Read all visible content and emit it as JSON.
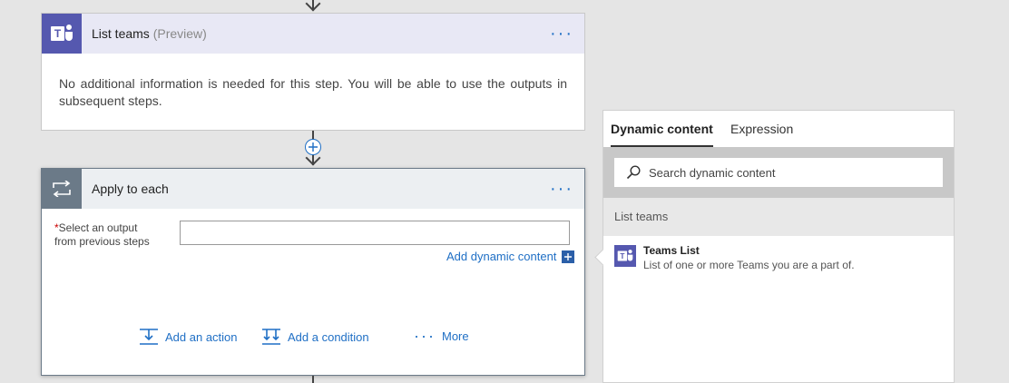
{
  "list_teams_card": {
    "title": "List teams",
    "preview": "(Preview)",
    "more": "···",
    "message": "No additional information is needed for this step. You will be able to use the outputs in subsequent steps."
  },
  "apply_card": {
    "title": "Apply to each",
    "more": "···",
    "required_marker": "*",
    "field_label_line1": "Select an output",
    "field_label_line2": "from previous steps",
    "field_value": "",
    "add_dynamic_content": "Add dynamic content",
    "add_action": "Add an action",
    "add_condition": "Add a condition",
    "more_dots": "···",
    "more_label": "More"
  },
  "dynamic_panel": {
    "tabs": [
      {
        "label": "Dynamic content",
        "active": true
      },
      {
        "label": "Expression",
        "active": false
      }
    ],
    "search_placeholder": "Search dynamic content",
    "section_title": "List teams",
    "items": [
      {
        "title": "Teams List",
        "description": "List of one or more Teams you are a part of.",
        "icon": "teams-icon"
      }
    ]
  },
  "colors": {
    "teams_brand": "#5558af",
    "link_blue": "#1f6fc5",
    "loop_gray": "#6b7a88"
  }
}
